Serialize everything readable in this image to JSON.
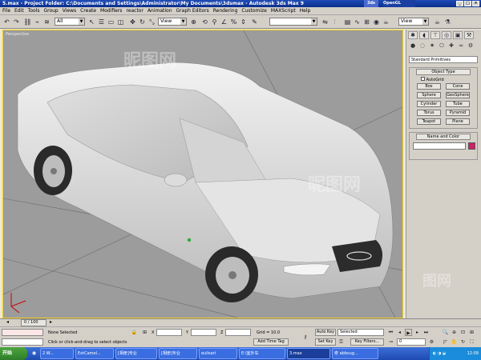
{
  "window": {
    "title": "5.max   - Project Folder: C:\\Documents and Settings\\Administrator\\My Documents\\3dsmax   - Autodesk 3ds Max 9",
    "openal": "OpenGL"
  },
  "menu": [
    "File",
    "Edit",
    "Tools",
    "Group",
    "Views",
    "Create",
    "Modifiers",
    "reactor",
    "Animation",
    "Graph Editors",
    "Rendering",
    "Customize",
    "MAXScript",
    "Help"
  ],
  "toolbar": {
    "selection_filter": "All",
    "ref_coord": "View",
    "named_selection": "",
    "render_view": "View"
  },
  "viewport": {
    "label": "Perspective"
  },
  "command_panel": {
    "category": "Standard Primitives",
    "object_type_title": "Object Type",
    "autogrid_label": "AutoGrid",
    "buttons": [
      "Box",
      "Cone",
      "Sphere",
      "GeoSphere",
      "Cylinder",
      "Tube",
      "Torus",
      "Pyramid",
      "Teapot",
      "Plane"
    ],
    "name_color_title": "Name and Color",
    "object_name": "",
    "color": "#d0206a"
  },
  "timeline": {
    "frame_counter": "0 / 100"
  },
  "status": {
    "selection": "None Selected",
    "prompt": "Click or click-and-drag to select objects",
    "x_label": "X",
    "y_label": "Y",
    "z_label": "Z",
    "x_value": "",
    "y_value": "",
    "z_value": "",
    "grid": "Grid = 10.0",
    "add_time_tag": "Add Time Tag",
    "auto_key": "Auto Key",
    "set_key": "Set Key",
    "key_mode": "Selected",
    "key_filters": "Key Filters...",
    "frame": "0"
  },
  "taskbar": {
    "start": "开始",
    "tasks": [
      "2 W...",
      "ExtCamel...",
      "[相册]专业",
      "[相册]专业",
      "eulisari",
      "E:\\室外车",
      "3.max",
      "奇 abbsug..."
    ],
    "clock": "12:09"
  }
}
